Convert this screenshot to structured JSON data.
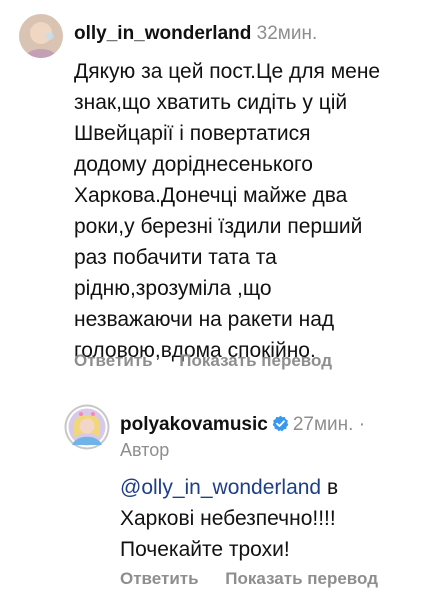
{
  "comment1": {
    "username": "olly_in_wonderland",
    "time": "32мин.",
    "text": "Дякую за цей пост.Це для мене\nзнак,що хватить сидіть у  цій\nШвейцарії і повертатися\nдодому доріднесенького\nХаркова.Донечці майже два\nроки,у березні їздили перший\nраз побачити тата та\nрідню,зрозуміла ,що\nнезважаючи на ракети над\nголовою,вдома спокійно.",
    "reply_label": "Ответить",
    "translate_label": "Показать перевод",
    "avatar_icon": "user-avatar-blonde"
  },
  "comment2": {
    "username": "polyakovamusic",
    "verified_icon": "verified-badge-icon",
    "time": "27мин.",
    "dot": "·",
    "author_label": "Автор",
    "mention": "@olly_in_wonderland",
    "text_line1_rest": "  в",
    "text_rest": "Харкові небезпечно!!!!\nПочекайте трохи!",
    "reply_label": "Ответить",
    "translate_label": "Показать перевод",
    "avatar_icon": "user-avatar-story-ring"
  },
  "colors": {
    "text": "#111111",
    "muted": "#8e8e8e",
    "mention": "#1d3f8a",
    "verified": "#3897f0"
  }
}
